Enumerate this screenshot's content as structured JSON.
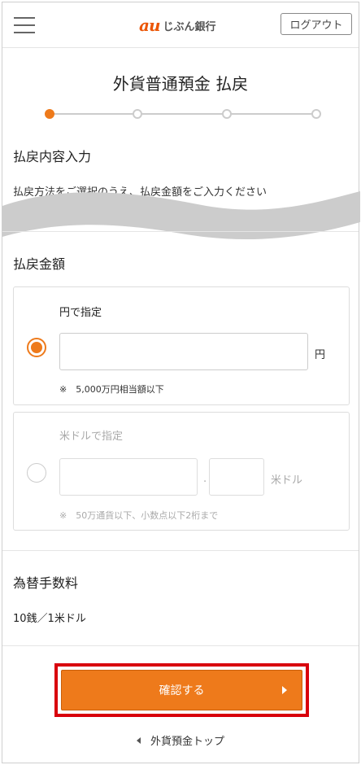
{
  "header": {
    "logo_mark": "au",
    "logo_text": "じぶん銀行",
    "logout_label": "ログアウト"
  },
  "page": {
    "title": "外貨普通預金 払戻"
  },
  "steps": {
    "total": 4,
    "current": 1
  },
  "content_section": {
    "title": "払戻内容入力",
    "description": "払戻方法をご選択のうえ、払戻金額をご入力ください"
  },
  "amount_section": {
    "title": "払戻金額",
    "yen_option": {
      "label": "円で指定",
      "selected": true,
      "value": "",
      "unit": "円",
      "note": "※　5,000万円相当額以下"
    },
    "usd_option": {
      "label": "米ドルで指定",
      "selected": false,
      "integer_value": "",
      "decimal_point": ".",
      "decimal_value": "",
      "unit": "米ドル",
      "note": "※　50万通貨以下、小数点以下2桁まで"
    }
  },
  "fee_section": {
    "title": "為替手数料",
    "value": "10銭／1米ドル"
  },
  "actions": {
    "confirm_label": "確認する",
    "back_link_label": "外貨預金トップ"
  },
  "colors": {
    "accent": "#ee7a1b",
    "highlight": "#d8000c",
    "brand": "#eb5505"
  }
}
